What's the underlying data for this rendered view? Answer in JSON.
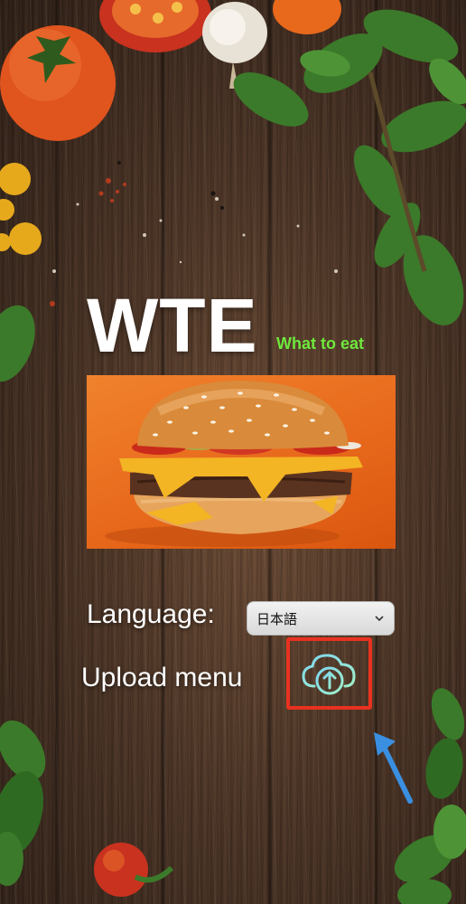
{
  "app": {
    "title": "WTE",
    "subtitle": "What to eat"
  },
  "form": {
    "language_label": "Language:",
    "language_selected": "日本語",
    "upload_label": "Upload menu"
  },
  "icons": {
    "upload": "cloud-upload-icon",
    "dropdown": "chevron-down-icon",
    "annotation": "arrow-icon"
  },
  "colors": {
    "title": "#ffffff",
    "subtitle": "#6ee83c",
    "upload_highlight": "#e8321f",
    "arrow": "#3a8fe0",
    "cloud_icon": "#7fe0d8"
  }
}
